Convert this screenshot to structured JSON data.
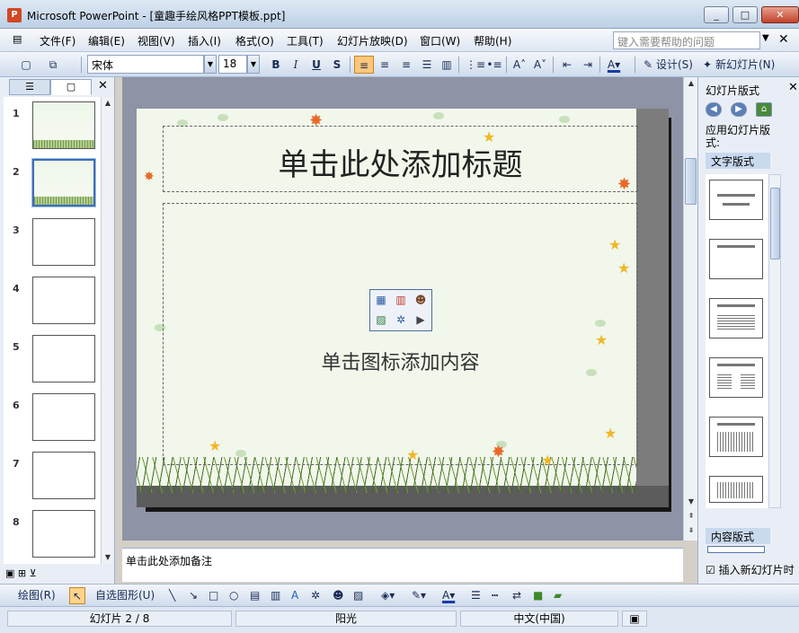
{
  "window": {
    "title": "Microsoft PowerPoint - [童趣手绘风格PPT模板.ppt]",
    "minimize": "_",
    "restore": "□",
    "close": "✕"
  },
  "menu": {
    "items": [
      "文件(F)",
      "编辑(E)",
      "视图(V)",
      "插入(I)",
      "格式(O)",
      "工具(T)",
      "幻灯片放映(D)",
      "窗口(W)",
      "帮助(H)"
    ],
    "help_placeholder": "键入需要帮助的问题",
    "close": "✕"
  },
  "toolbar": {
    "font_name": "宋体",
    "font_size": "18",
    "bold": "B",
    "italic": "I",
    "underline": "U",
    "shadow": "S",
    "design_label": "设计(S)",
    "new_slide_label": "新幻灯片(N)"
  },
  "left_pane": {
    "tab_outline": "☰",
    "tab_slides": "▢",
    "close": "✕",
    "slides": [
      {
        "num": "1"
      },
      {
        "num": "2"
      },
      {
        "num": "3"
      },
      {
        "num": "4"
      },
      {
        "num": "5"
      },
      {
        "num": "6"
      },
      {
        "num": "7"
      },
      {
        "num": "8"
      }
    ],
    "selected_slide": 2
  },
  "slide": {
    "title_placeholder": "单击此处添加标题",
    "content_placeholder": "单击图标添加内容"
  },
  "notes": {
    "placeholder": "单击此处添加备注"
  },
  "task_pane": {
    "title": "幻灯片版式",
    "close": "✕",
    "apply_label": "应用幻灯片版式:",
    "section_text": "文字版式",
    "section_content": "内容版式",
    "insert_new_slide_label": "插入新幻灯片时"
  },
  "drawing_toolbar": {
    "draw_label": "绘图(R)",
    "autoshapes_label": "自选图形(U)"
  },
  "status": {
    "slide_pos": "幻灯片 2 / 8",
    "design": "阳光",
    "language": "中文(中国)"
  }
}
